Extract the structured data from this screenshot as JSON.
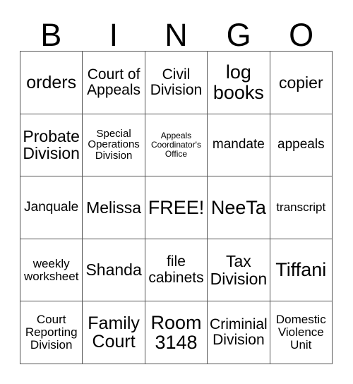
{
  "card": {
    "headers": [
      "B",
      "I",
      "N",
      "G",
      "O"
    ],
    "free_space_label": "FREE!",
    "colors": {
      "background": "#ffffff",
      "border": "#555555",
      "text": "#000000"
    },
    "rows": [
      [
        {
          "text": "orders",
          "size": "fs-25"
        },
        {
          "text": "Court of\nAppeals",
          "size": "fs-21"
        },
        {
          "text": "Civil\nDivision",
          "size": "fs-21"
        },
        {
          "text": "log\nbooks",
          "size": "fs-27"
        },
        {
          "text": "copier",
          "size": "fs-23"
        }
      ],
      [
        {
          "text": "Probate\nDivision",
          "size": "fs-23"
        },
        {
          "text": "Special\nOperations\nDivision",
          "size": "fs-15"
        },
        {
          "text": "Appeals\nCoordinator's\nOffice",
          "size": "fs-12"
        },
        {
          "text": "mandate",
          "size": "fs-19"
        },
        {
          "text": "appeals",
          "size": "fs-19"
        }
      ],
      [
        {
          "text": "Janquale",
          "size": "fs-19"
        },
        {
          "text": "Melissa",
          "size": "fs-23"
        },
        {
          "text": "FREE!",
          "size": "fs-27"
        },
        {
          "text": "NeeTa",
          "size": "fs-27"
        },
        {
          "text": "transcript",
          "size": "fs-17"
        }
      ],
      [
        {
          "text": "weekly\nworksheet",
          "size": "fs-17"
        },
        {
          "text": "Shanda",
          "size": "fs-23"
        },
        {
          "text": "file\ncabinets",
          "size": "fs-21"
        },
        {
          "text": "Tax\nDivision",
          "size": "fs-23"
        },
        {
          "text": "Tiffani",
          "size": "fs-27"
        }
      ],
      [
        {
          "text": "Court\nReporting\nDivision",
          "size": "fs-17"
        },
        {
          "text": "Family\nCourt",
          "size": "fs-25"
        },
        {
          "text": "Room\n3148",
          "size": "fs-27"
        },
        {
          "text": "Criminial\nDivision",
          "size": "fs-21"
        },
        {
          "text": "Domestic\nViolence\nUnit",
          "size": "fs-17"
        }
      ]
    ]
  }
}
